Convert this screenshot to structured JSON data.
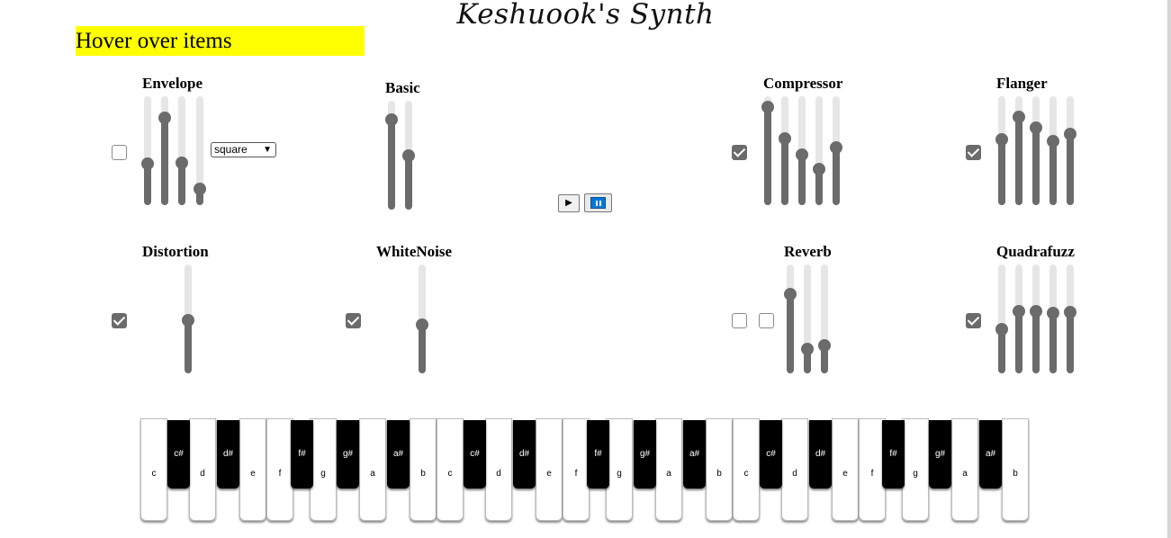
{
  "title": "Keshuook's Synth",
  "hover_text": "Hover over items",
  "transport": {
    "play_symbol": "▶",
    "pause_label": "pause"
  },
  "panels": {
    "envelope": {
      "title": "Envelope",
      "enabled": false,
      "sliders": [
        0.36,
        0.84,
        0.37,
        0.1
      ],
      "waveform": "square"
    },
    "basic": {
      "title": "Basic",
      "sliders": [
        0.87,
        0.5
      ]
    },
    "compressor": {
      "title": "Compressor",
      "enabled": true,
      "sliders": [
        0.95,
        0.63,
        0.46,
        0.31,
        0.53
      ]
    },
    "flanger": {
      "title": "Flanger",
      "enabled": true,
      "sliders": [
        0.62,
        0.85,
        0.74,
        0.6,
        0.67
      ]
    },
    "distortion": {
      "title": "Distortion",
      "enabled": true,
      "sliders": [
        0.49
      ]
    },
    "whitenoise": {
      "title": "WhiteNoise",
      "enabled": true,
      "sliders": [
        0.44
      ]
    },
    "reverb": {
      "title": "Reverb",
      "toggle1": false,
      "toggle2": false,
      "sliders": [
        0.76,
        0.19,
        0.22
      ]
    },
    "quadrafuzz": {
      "title": "Quadrafuzz",
      "enabled": true,
      "sliders": [
        0.39,
        0.58,
        0.58,
        0.56,
        0.57
      ]
    }
  },
  "keyboard": {
    "white": [
      "c",
      "d",
      "e",
      "f",
      "g",
      "a",
      "b",
      "c",
      "d",
      "e",
      "f",
      "g",
      "a",
      "b",
      "c",
      "d",
      "e",
      "f",
      "g",
      "a",
      "b"
    ],
    "black": [
      "c#",
      "d#",
      "f#",
      "g#",
      "a#",
      "c#",
      "d#",
      "f#",
      "g#",
      "a#",
      "c#",
      "d#",
      "f#",
      "g#",
      "a#"
    ]
  },
  "colors": {
    "highlight": "#ffff00",
    "slider_fill": "#6b6b6b",
    "slider_track": "#e6e6e6",
    "accent": "#0078d7"
  }
}
